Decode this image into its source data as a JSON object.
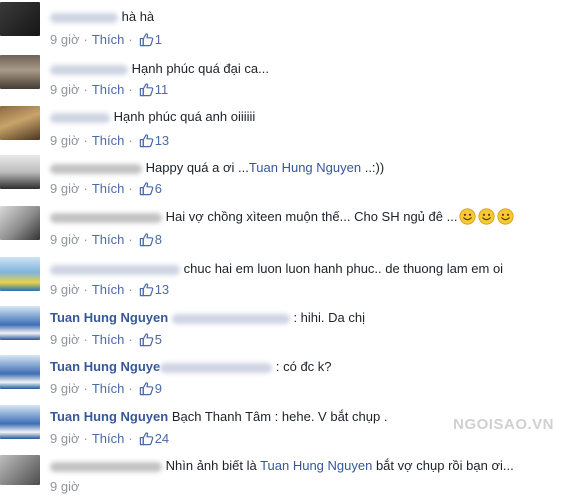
{
  "comments": [
    {
      "text": "hà hà",
      "time": "9 giờ",
      "like_label": "Thích",
      "likes": "1"
    },
    {
      "text": "Hạnh phúc quá đại ca...",
      "time": "9 giờ",
      "like_label": "Thích",
      "likes": "11"
    },
    {
      "text": "Hạnh phúc quá anh oiiiiii",
      "time": "9 giờ",
      "like_label": "Thích",
      "likes": "13"
    },
    {
      "text": "Happy quá a ơi ...",
      "tag": "Tuan Hung Nguyen",
      "text_after": " ..:))",
      "time": "9 giờ",
      "like_label": "Thích",
      "likes": "6"
    },
    {
      "text": "Hai vợ chồng xìteen muộn thế... Cho SH ngủ đê ...",
      "time": "9 giờ",
      "like_label": "Thích",
      "likes": "8"
    },
    {
      "text": "chuc hai em luon luon hanh phuc.. de thuong lam em oi",
      "time": "9 giờ",
      "like_label": "Thích",
      "likes": "13"
    },
    {
      "author": "Tuan Hung Nguyen",
      "text": ": hihi. Da chị",
      "time": "9 giờ",
      "like_label": "Thích",
      "likes": "5"
    },
    {
      "author": "Tuan Hung Nguye",
      "text": ": có đc k?",
      "time": "9 giờ",
      "like_label": "Thích",
      "likes": "9"
    },
    {
      "author": "Tuan Hung Nguyen",
      "text": "Bạch Thanh Tâm : hehe. V bắt chụp .",
      "time": "9 giờ",
      "like_label": "Thích",
      "likes": "24"
    },
    {
      "text": "Nhìn ảnh biết là ",
      "tag": "Tuan Hung Nguyen",
      "text_after": " bắt vợ chụp rồi bạn ơi...",
      "time": "9 giờ"
    }
  ],
  "watermark": "NGOISAO.VN",
  "colors": {
    "link": "#365899",
    "meta": "#90949c",
    "like_icon": "#4b6aa8"
  }
}
